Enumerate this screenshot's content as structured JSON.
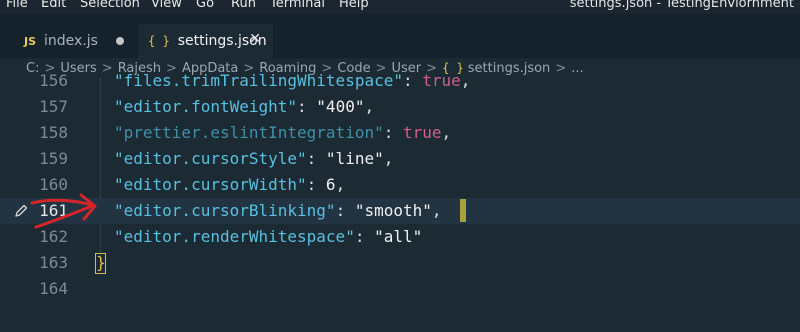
{
  "menubar": {
    "items": [
      "File",
      "Edit",
      "Selection",
      "View",
      "Go",
      "Run",
      "Terminal",
      "Help"
    ],
    "window_title": "settings.json - TestingEnviornment"
  },
  "tabs": [
    {
      "label": "index.js",
      "icon": "js-icon",
      "icon_text": "JS",
      "modified": true,
      "active": false
    },
    {
      "label": "settings.json",
      "icon": "braces-icon",
      "icon_text": "{ }",
      "active": true
    }
  ],
  "breadcrumb": {
    "items": [
      "C:",
      "Users",
      "Rajesh",
      "AppData",
      "Roaming",
      "Code",
      "User",
      "settings.json",
      "..."
    ],
    "file_icon": "{ }"
  },
  "editor": {
    "lines": [
      {
        "number": "156",
        "key": "\"files.trimTrailingWhitespace\"",
        "sep": ": ",
        "value": "true",
        "value_type": "bool",
        "end": ","
      },
      {
        "number": "157",
        "key": "\"editor.fontWeight\"",
        "sep": ": ",
        "value": "\"400\"",
        "value_type": "string",
        "end": ","
      },
      {
        "number": "158",
        "key": "\"prettier.eslintIntegration\"",
        "sep": ": ",
        "value": "true",
        "value_type": "bool",
        "end": ","
      },
      {
        "number": "159",
        "key": "\"editor.cursorStyle\"",
        "sep": ": ",
        "value": "\"line\"",
        "value_type": "string",
        "end": ","
      },
      {
        "number": "160",
        "key": "\"editor.cursorWidth\"",
        "sep": ": ",
        "value": "6",
        "value_type": "number",
        "end": ","
      },
      {
        "number": "161",
        "key": "\"editor.cursorBlinking\"",
        "sep": ": ",
        "value": "\"smooth\"",
        "value_type": "string",
        "end": ","
      },
      {
        "number": "162",
        "key": "\"editor.renderWhitespace\"",
        "sep": ": ",
        "value": "\"all\"",
        "value_type": "string",
        "end": ""
      },
      {
        "number": "163",
        "brace": "}"
      },
      {
        "number": "164"
      }
    ],
    "active_line": "161",
    "colors": {
      "key": "#58c0e0",
      "string": "#f0f0f0",
      "bool": "#d35d8a",
      "cursor": "#a8a13a",
      "annotation": "#d4262a"
    }
  }
}
